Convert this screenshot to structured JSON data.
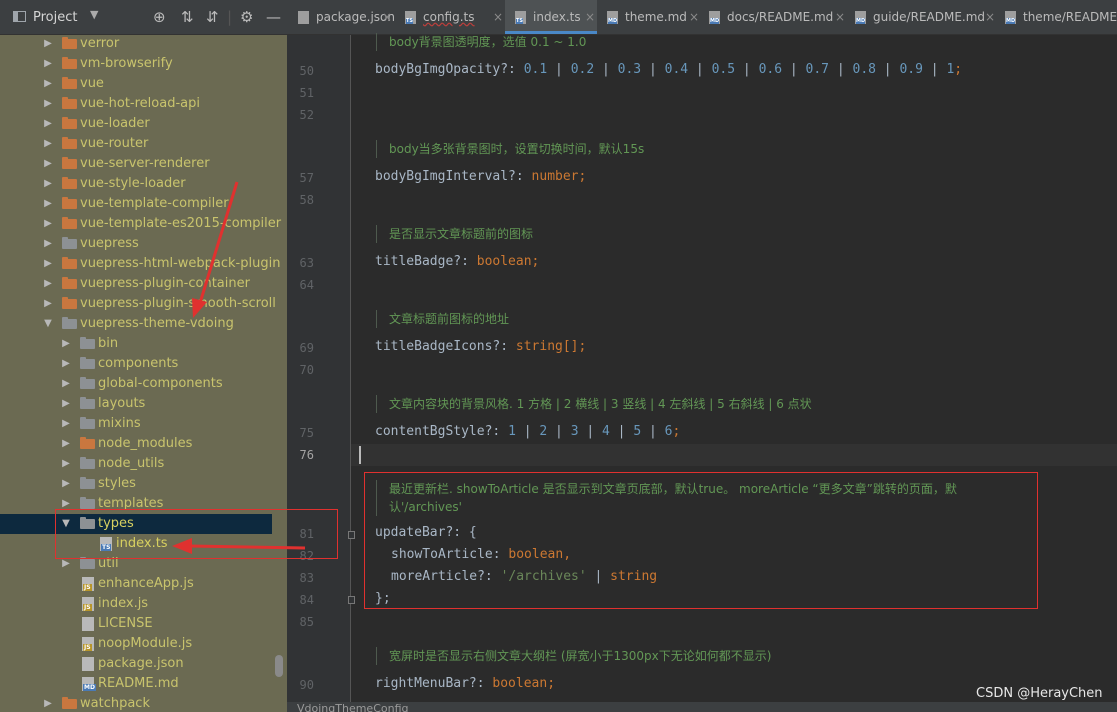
{
  "project_panel": {
    "title": "Project",
    "header_icons": [
      "crosshair-icon",
      "expand-all-icon",
      "collapse-all-icon",
      "gear-icon"
    ]
  },
  "tree": [
    {
      "label": "verror",
      "level": 1,
      "kind": "folder",
      "color": "orange",
      "arrow": "right"
    },
    {
      "label": "vm-browserify",
      "level": 1,
      "kind": "folder",
      "color": "orange",
      "arrow": "right"
    },
    {
      "label": "vue",
      "level": 1,
      "kind": "folder",
      "color": "orange",
      "arrow": "right"
    },
    {
      "label": "vue-hot-reload-api",
      "level": 1,
      "kind": "folder",
      "color": "orange",
      "arrow": "right"
    },
    {
      "label": "vue-loader",
      "level": 1,
      "kind": "folder",
      "color": "orange",
      "arrow": "right"
    },
    {
      "label": "vue-router",
      "level": 1,
      "kind": "folder",
      "color": "orange",
      "arrow": "right"
    },
    {
      "label": "vue-server-renderer",
      "level": 1,
      "kind": "folder",
      "color": "orange",
      "arrow": "right"
    },
    {
      "label": "vue-style-loader",
      "level": 1,
      "kind": "folder",
      "color": "orange",
      "arrow": "right"
    },
    {
      "label": "vue-template-compiler",
      "level": 1,
      "kind": "folder",
      "color": "orange",
      "arrow": "right"
    },
    {
      "label": "vue-template-es2015-compiler",
      "level": 1,
      "kind": "folder",
      "color": "orange",
      "arrow": "right"
    },
    {
      "label": "vuepress",
      "level": 1,
      "kind": "folder",
      "color": "gray",
      "arrow": "right"
    },
    {
      "label": "vuepress-html-webpack-plugin",
      "level": 1,
      "kind": "folder",
      "color": "orange",
      "arrow": "right"
    },
    {
      "label": "vuepress-plugin-container",
      "level": 1,
      "kind": "folder",
      "color": "orange",
      "arrow": "right"
    },
    {
      "label": "vuepress-plugin-smooth-scroll",
      "level": 1,
      "kind": "folder",
      "color": "orange",
      "arrow": "right"
    },
    {
      "label": "vuepress-theme-vdoing",
      "level": 1,
      "kind": "folder",
      "color": "gray",
      "arrow": "down"
    },
    {
      "label": "bin",
      "level": 2,
      "kind": "folder",
      "color": "gray",
      "arrow": "right"
    },
    {
      "label": "components",
      "level": 2,
      "kind": "folder",
      "color": "gray",
      "arrow": "right"
    },
    {
      "label": "global-components",
      "level": 2,
      "kind": "folder",
      "color": "gray",
      "arrow": "right"
    },
    {
      "label": "layouts",
      "level": 2,
      "kind": "folder",
      "color": "gray",
      "arrow": "right"
    },
    {
      "label": "mixins",
      "level": 2,
      "kind": "folder",
      "color": "gray",
      "arrow": "right"
    },
    {
      "label": "node_modules",
      "level": 2,
      "kind": "folder",
      "color": "orange",
      "arrow": "right"
    },
    {
      "label": "node_utils",
      "level": 2,
      "kind": "folder",
      "color": "gray",
      "arrow": "right"
    },
    {
      "label": "styles",
      "level": 2,
      "kind": "folder",
      "color": "gray",
      "arrow": "right"
    },
    {
      "label": "templates",
      "level": 2,
      "kind": "folder",
      "color": "gray",
      "arrow": "right"
    },
    {
      "label": "types",
      "level": 2,
      "kind": "folder",
      "color": "gray",
      "arrow": "down",
      "selected": true
    },
    {
      "label": "index.ts",
      "level": 3,
      "kind": "file",
      "badge": "TS"
    },
    {
      "label": "util",
      "level": 2,
      "kind": "folder",
      "color": "gray",
      "arrow": "right"
    },
    {
      "label": "enhanceApp.js",
      "level": 2,
      "kind": "file",
      "badge": "JS"
    },
    {
      "label": "index.js",
      "level": 2,
      "kind": "file",
      "badge": "JS"
    },
    {
      "label": "LICENSE",
      "level": 2,
      "kind": "file",
      "badge": ""
    },
    {
      "label": "noopModule.js",
      "level": 2,
      "kind": "file",
      "badge": "JS"
    },
    {
      "label": "package.json",
      "level": 2,
      "kind": "file",
      "badge": ""
    },
    {
      "label": "README.md",
      "level": 2,
      "kind": "file",
      "badge": "MD"
    },
    {
      "label": "watchpack",
      "level": 1,
      "kind": "folder",
      "color": "orange",
      "arrow": "right"
    }
  ],
  "tabs": [
    {
      "label": "package.json",
      "badge": "",
      "active": false,
      "error": false
    },
    {
      "label": "config.ts",
      "badge": "TS",
      "active": false,
      "error": true
    },
    {
      "label": "index.ts",
      "badge": "TS",
      "active": true,
      "error": false
    },
    {
      "label": "theme.md",
      "badge": "MD",
      "active": false,
      "error": false
    },
    {
      "label": "docs/README.md",
      "badge": "MD",
      "active": false,
      "error": false
    },
    {
      "label": "guide/README.md",
      "badge": "MD",
      "active": false,
      "error": false
    },
    {
      "label": "theme/README.md",
      "badge": "MD",
      "active": false,
      "error": false
    }
  ],
  "line_numbers": [
    "50",
    "51",
    "52",
    "57",
    "58",
    "63",
    "64",
    "69",
    "70",
    "75",
    "76",
    "81",
    "82",
    "83",
    "84",
    "85",
    "90"
  ],
  "docs": {
    "d1": "body背景图透明度，选值 0.1 ~ 1.0",
    "d2": "body当多张背景图时，设置切换时间，默认15s",
    "d3": "是否显示文章标题前的图标",
    "d4": "文章标题前图标的地址",
    "d5": "文章内容块的背景风格. 1 方格 | 2 横线 | 3 竖线 | 4 左斜线 | 5 右斜线 | 6 点状",
    "d6a": "最近更新栏. showToArticle 是否显示到文章页底部，默认true。 moreArticle “更多文章”跳转的页面，默",
    "d6b": "认'/archives'",
    "d7": "宽屏时是否显示右侧文章大纲栏 (屏宽小于1300px下无论如何都不显示)"
  },
  "code": {
    "l50_name": "bodyBgImgOpacity?: ",
    "l50_values": [
      "0.1",
      "0.2",
      "0.3",
      "0.4",
      "0.5",
      "0.6",
      "0.7",
      "0.8",
      "0.9",
      "1"
    ],
    "l57_name": "bodyBgImgInterval?: ",
    "l57_type": "number",
    "l63_name": "titleBadge?: ",
    "l63_type": "boolean",
    "l69_name": "titleBadgeIcons?: ",
    "l69_type": "string[]",
    "l75_name": "contentBgStyle?: ",
    "l75_values": [
      "1",
      "2",
      "3",
      "4",
      "5",
      "6"
    ],
    "l81_name": "updateBar?: ",
    "l81_brace": "{",
    "l82_name": "showToArticle: ",
    "l82_type": "boolean",
    "l83_name": "moreArticle?: ",
    "l83_str": "'/archives'",
    "l83_type": "string",
    "l84_close": "};",
    "l90_name": "rightMenuBar?: ",
    "l90_type": "boolean"
  },
  "status_bar": {
    "breadcrumb": "VdoingThemeConfig"
  },
  "watermark": "CSDN @HerayChen",
  "colors": {
    "highlight_red": "#e0312f",
    "selection": "#0d293e",
    "tree_bg": "#6b6a52"
  }
}
